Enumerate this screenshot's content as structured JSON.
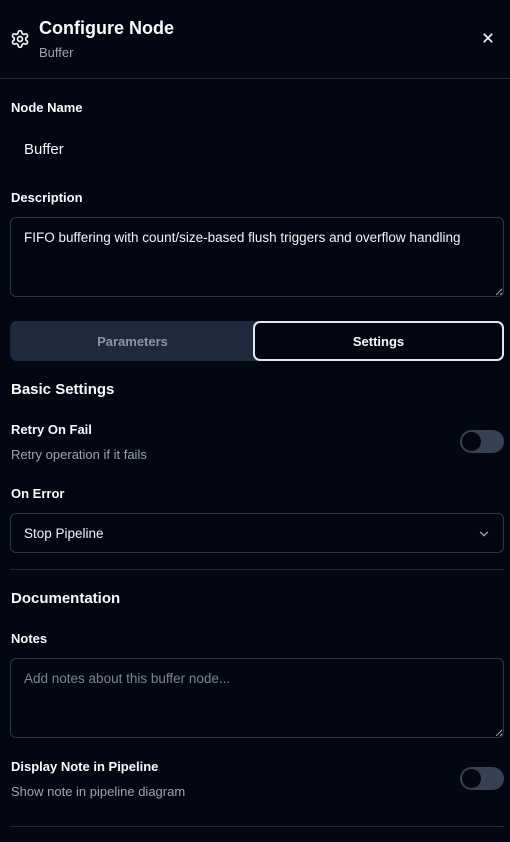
{
  "header": {
    "title": "Configure Node",
    "subtitle": "Buffer"
  },
  "node_name": {
    "label": "Node Name",
    "value": "Buffer"
  },
  "description": {
    "label": "Description",
    "value": "FIFO buffering with count/size-based flush triggers and overflow handling"
  },
  "tabs": [
    {
      "label": "Parameters",
      "active": false
    },
    {
      "label": "Settings",
      "active": true
    }
  ],
  "basic_settings": {
    "heading": "Basic Settings",
    "retry_on_fail": {
      "label": "Retry On Fail",
      "helper": "Retry operation if it fails",
      "enabled": false
    },
    "on_error": {
      "label": "On Error",
      "selected": "Stop Pipeline"
    }
  },
  "documentation": {
    "heading": "Documentation",
    "notes": {
      "label": "Notes",
      "placeholder": "Add notes about this buffer node..."
    },
    "display_note": {
      "label": "Display Note in Pipeline",
      "helper": "Show note in pipeline diagram",
      "enabled": false
    }
  },
  "icons": {
    "header": "gear-icon",
    "close": "close-icon",
    "select": "chevron-down-icon"
  },
  "colors": {
    "background": "#030712",
    "border": "#2d3748",
    "muted_text": "#9ca3af",
    "toggle_off": "#374151"
  }
}
